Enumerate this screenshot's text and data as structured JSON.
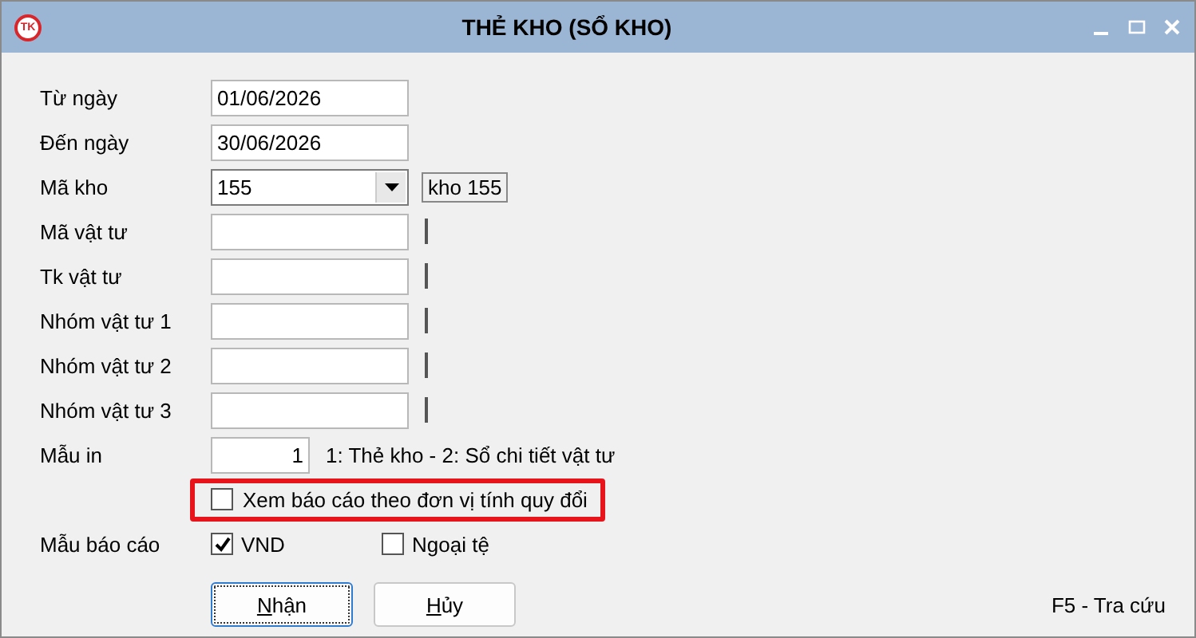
{
  "window": {
    "title": "THẺ KHO (SỔ KHO)",
    "logo": "TK"
  },
  "fields": [
    {
      "kind": "text",
      "label": "Từ ngày",
      "value": "01/06/2026"
    },
    {
      "kind": "text",
      "label": "Đến ngày",
      "value": "30/06/2026"
    },
    {
      "kind": "combo",
      "label": "Mã kho",
      "value": "155",
      "caption": "kho 155"
    },
    {
      "kind": "lookup",
      "label": "Mã vật tư"
    },
    {
      "kind": "lookup",
      "label": "Tk vật tư"
    },
    {
      "kind": "lookup",
      "label": "Nhóm vật tư 1"
    },
    {
      "kind": "lookup",
      "label": "Nhóm vật tư 2"
    },
    {
      "kind": "lookup",
      "label": "Nhóm vật tư 3"
    },
    {
      "kind": "number",
      "label": "Mẫu in",
      "value": "1",
      "hint": "1: Thẻ kho - 2: Sổ chi tiết vật tư"
    }
  ],
  "convert_option": {
    "label": "Xem báo cáo theo đơn vị tính quy đổi",
    "checked": false,
    "highlighted": true
  },
  "report_template": {
    "label": "Mẫu báo cáo",
    "options": [
      {
        "label": "VND",
        "checked": true
      },
      {
        "label": "Ngoại tệ",
        "checked": false
      }
    ]
  },
  "buttons": [
    {
      "label": "Nhận",
      "focused": true
    },
    {
      "label": "Hủy",
      "focused": false
    }
  ],
  "shortcut_hint": "F5 - Tra cứu"
}
